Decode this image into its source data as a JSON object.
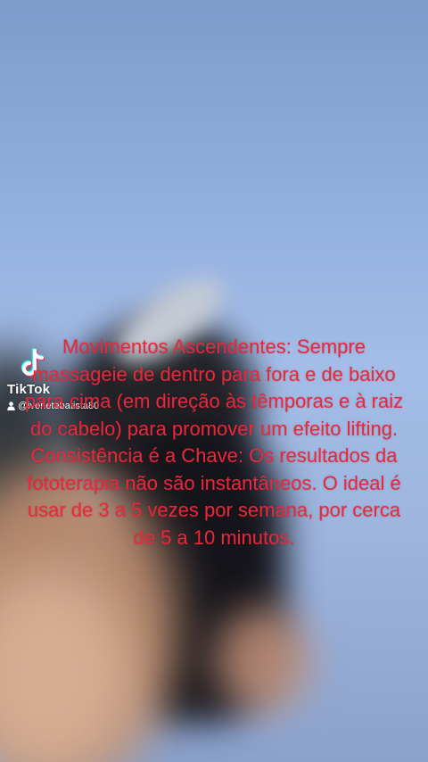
{
  "watermark": {
    "brand": "TikTok",
    "username": "@ivonetebatista80",
    "logo_icon": "tiktok-note-icon",
    "user_icon": "person-icon"
  },
  "caption": {
    "paragraph_1": "Movimentos Ascendentes: Sempre massageie de dentro para fora e de baixo para cima (em direção às têmporas e à raiz do cabelo) para promover um efeito lifting.",
    "paragraph_2": "Consistência é a Chave: Os resultados da fototerapia não são instantâneos. O ideal é usar de 3 a 5 vezes por semana, por cerca de 5 a 10 minutos."
  },
  "colors": {
    "caption_text": "#e8283c",
    "sky_blue": "#a3bde8",
    "watermark_text": "#ffffff",
    "logo_cyan": "#25f4ee",
    "logo_pink": "#fe2c55"
  }
}
